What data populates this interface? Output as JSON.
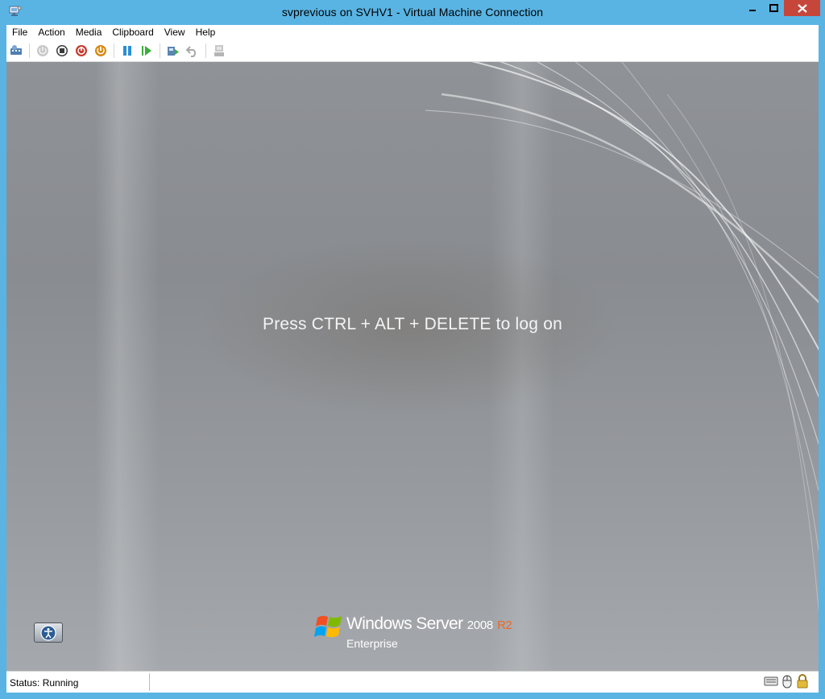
{
  "window": {
    "title": "svprevious on SVHV1 - Virtual Machine Connection"
  },
  "menu": {
    "items": [
      "File",
      "Action",
      "Media",
      "Clipboard",
      "View",
      "Help"
    ]
  },
  "toolbar": {
    "buttons": [
      {
        "icon": "ctrl-alt-del-icon"
      },
      {
        "icon": "start-icon"
      },
      {
        "icon": "turn-off-icon"
      },
      {
        "icon": "shut-down-icon"
      },
      {
        "icon": "save-icon"
      },
      {
        "icon": "pause-icon"
      },
      {
        "icon": "resume-icon"
      },
      {
        "icon": "checkpoint-icon"
      },
      {
        "icon": "revert-icon"
      },
      {
        "icon": "enhanced-session-icon"
      }
    ]
  },
  "screen": {
    "message": "Press CTRL + ALT + DELETE to log on",
    "brand": {
      "name": "Windows Server",
      "version": "2008",
      "release": "R2",
      "edition": "Enterprise"
    }
  },
  "status": {
    "text": "Status: Running"
  },
  "colors": {
    "frame": "#59b4e3",
    "close_button": "#c7463b",
    "r2_accent": "#e86a2c"
  }
}
